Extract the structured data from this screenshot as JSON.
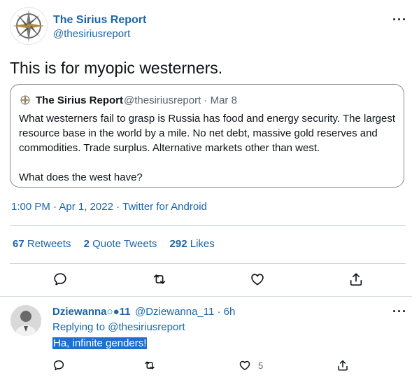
{
  "tweet": {
    "display_name": "The Sirius Report",
    "handle": "@thesiriusreport",
    "text": "This is for myopic westerners.",
    "meta": "1:00 PM · Apr 1, 2022 · Twitter for Android",
    "more_label": "···"
  },
  "quote": {
    "display_name": "The Sirius Report",
    "handle_date": "@thesiriusreport · Mar 8",
    "line1": "What westerners fail to grasp is Russia has food and energy security. The largest",
    "line2": "resource base in the world by a mile. No net debt, massive gold reserves and",
    "line3": "commodities. Trade surplus. Alternative markets other than west.",
    "line4": "What does the west have?"
  },
  "stats": {
    "retweets_count": "67",
    "retweets_label": "Retweets",
    "quotes_count": "2",
    "quotes_label": "Quote Tweets",
    "likes_count": "292",
    "likes_label": "Likes"
  },
  "reply": {
    "display_name": "Dziewanna○●11",
    "handle_time": "@Dziewanna_11 · 6h",
    "replying_to_label": "Replying to",
    "replying_to_handle": "@thesiriusreport",
    "text": "Ha, infinite genders!",
    "like_count": "5",
    "more_label": "···"
  },
  "icons": {
    "reply": "comment-icon",
    "retweet": "retweet-icon",
    "like": "heart-icon",
    "share": "share-icon"
  },
  "colors": {
    "link": "#1b65a8",
    "text": "#0f1419",
    "muted": "#536471",
    "selection": "#1f6fd1"
  }
}
